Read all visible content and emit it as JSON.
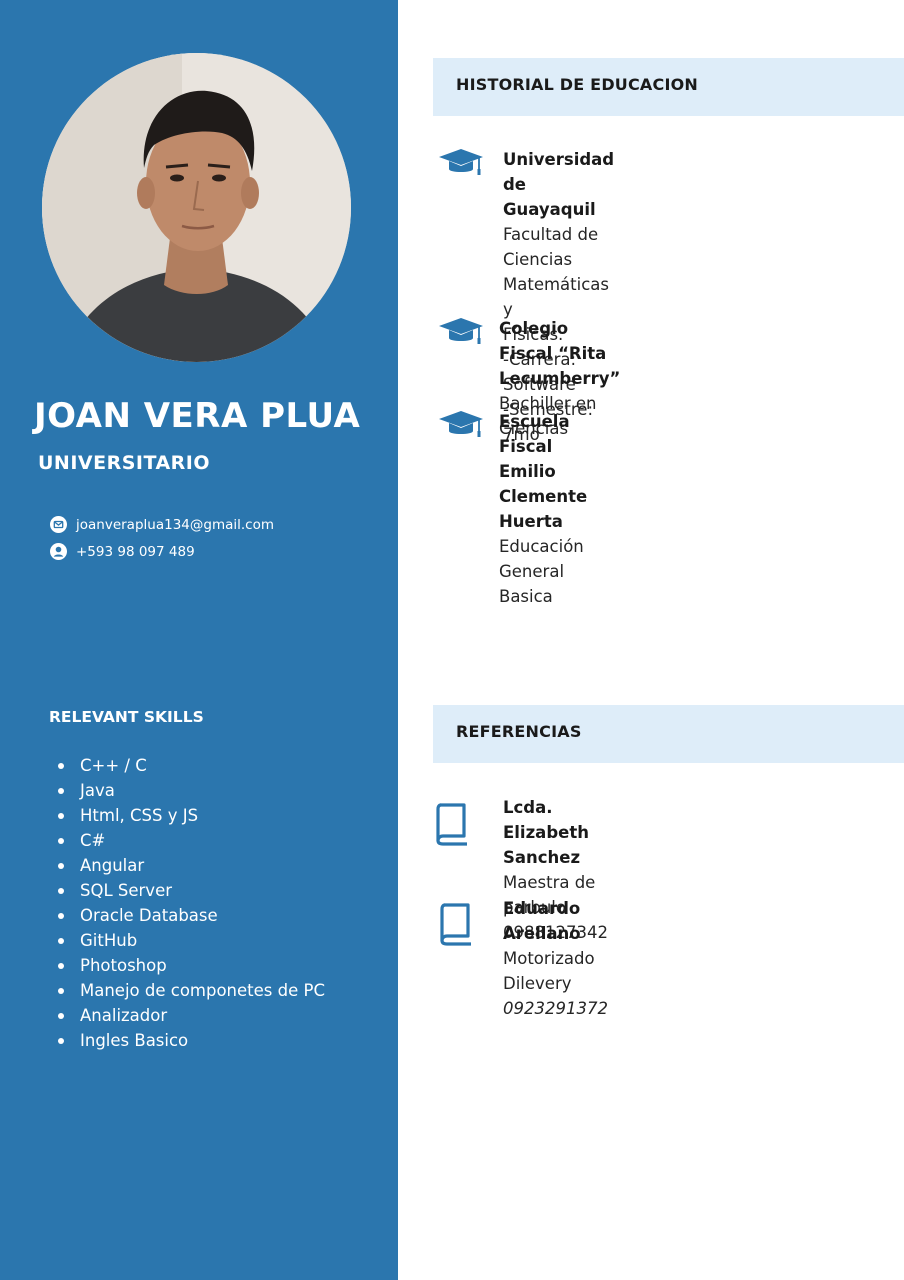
{
  "profile": {
    "name": "JOAN VERA PLUA",
    "role": "UNIVERSITARIO"
  },
  "contact": {
    "email": "joanveraplua134@gmail.com",
    "phone": "+593 98 097 489",
    "email_icon": "mail-icon",
    "phone_icon": "user-circle-icon"
  },
  "skills": {
    "title": "RELEVANT SKILLS",
    "items": [
      "C++ / C",
      "Java",
      "Html, CSS y JS",
      "C#",
      "Angular",
      "SQL Server",
      "Oracle Database",
      "GitHub",
      "Photoshop",
      "Manejo de componetes de PC",
      "Analizador",
      "Ingles Basico"
    ]
  },
  "education": {
    "title": "HISTORIAL DE EDUCACION",
    "icon": "graduation-cap-icon",
    "entries": [
      {
        "title": "Universidad de Guayaquil",
        "lines": [
          "Facultad de Ciencias Matemáticas y",
          "Físicas.",
          "-Carrera: Software",
          "-Semestre: 7mo"
        ]
      },
      {
        "title": "Colegio Fiscal “Rita Lecumberry”",
        "lines": [
          "Bachiller en Ciencias"
        ]
      },
      {
        "title": "Escuela Fiscal Emilio Clemente",
        "title2": "Huerta",
        "lines": [
          "Educación General Basica"
        ]
      }
    ]
  },
  "references": {
    "title": "REFERENCIAS",
    "icon": "book-icon",
    "entries": [
      {
        "name": "Lcda. Elizabeth Sanchez",
        "role": "Maestra de parbulo",
        "phone": "0988127342"
      },
      {
        "name": "Eduardo Arellano",
        "role": "Motorizado Dilevery",
        "phone": "0923291372"
      }
    ]
  },
  "colors": {
    "sidebar": "#2b76ae",
    "section_header": "#deedf9",
    "icon": "#2b76ae",
    "text": "#1a1a1a"
  }
}
